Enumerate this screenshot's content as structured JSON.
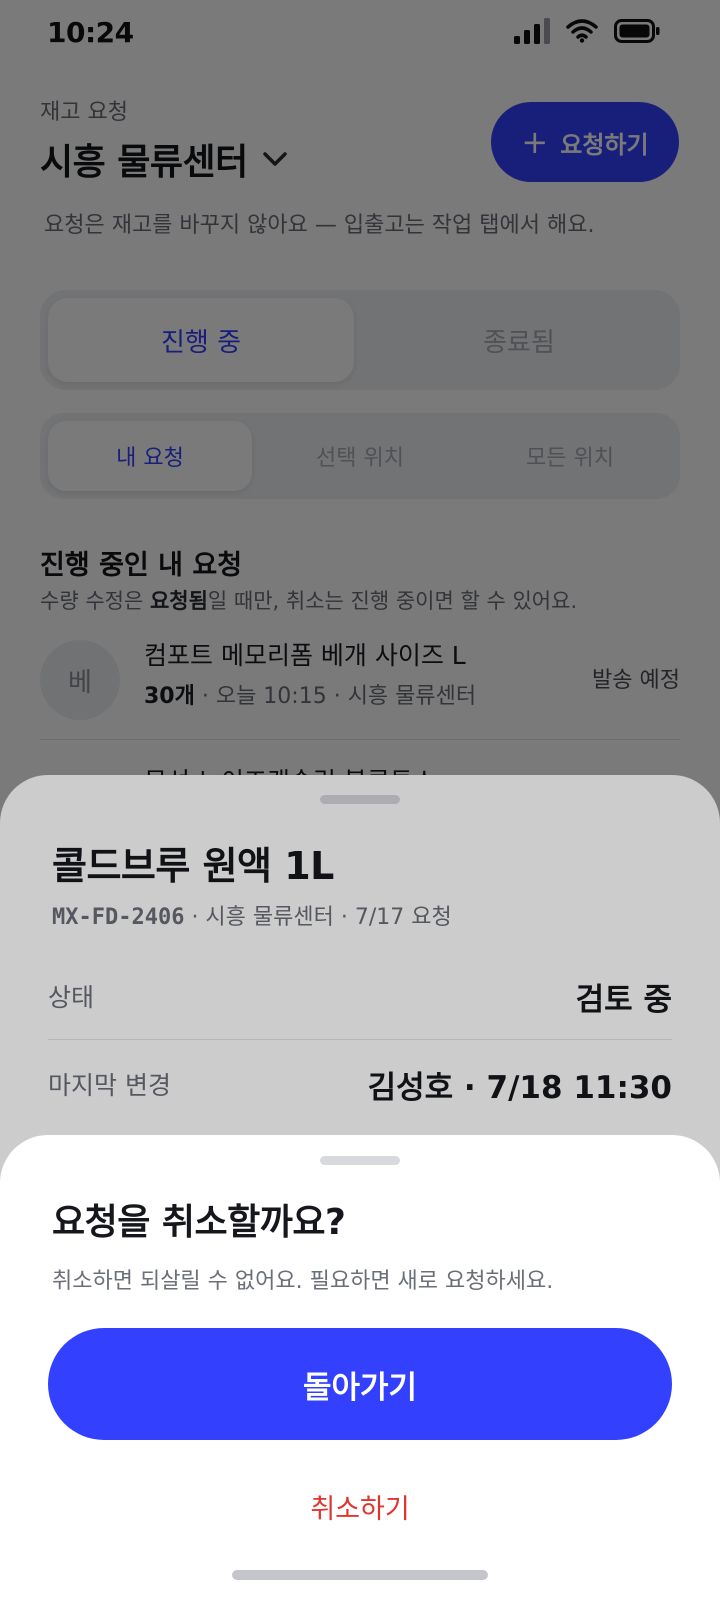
{
  "status_bar": {
    "time": "10:24"
  },
  "header": {
    "eyebrow": "재고 요청",
    "location": "시흥 물류센터",
    "new_request_label": "요청하기",
    "hint": "요청은 재고를 바꾸지 않아요 — 입출고는 작업 탭에서 해요."
  },
  "status_tabs": [
    "진행 중",
    "종료됨"
  ],
  "scope_tabs": [
    "내 요청",
    "선택 위치",
    "모든 위치"
  ],
  "section": {
    "title": "진행 중인 내 요청",
    "hint_prefix": "수량 수정은 ",
    "hint_bold": "요청됨",
    "hint_suffix": "일 때만, 취소는 진행 중이면 할 수 있어요."
  },
  "requests": [
    {
      "avatar": "베",
      "name": "컴포트 메모리폼 베개 사이즈 L",
      "qty": "30개",
      "meta": " · 오늘 10:15 · 시흥 물류센터",
      "status": "발송 예정"
    },
    {
      "name": "무선 노이즈캔슬링 블루투스"
    }
  ],
  "detail": {
    "title": "콜드브루 원액 1L",
    "code": "MX-FD-2406",
    "meta": " · 시흥 물류센터 · 7/17 요청",
    "rows": [
      {
        "label": "상태",
        "value": "검토 중"
      },
      {
        "label": "마지막 변경",
        "value": "김성호 · 7/18 11:30"
      }
    ]
  },
  "confirm": {
    "title": "요청을 취소할까요?",
    "description": "취소하면 되살릴 수 없어요. 필요하면 새로 요청하세요.",
    "primary_label": "돌아가기",
    "destructive_label": "취소하기"
  },
  "colors": {
    "accent": "#3341ff",
    "destructive": "#e0352f"
  }
}
